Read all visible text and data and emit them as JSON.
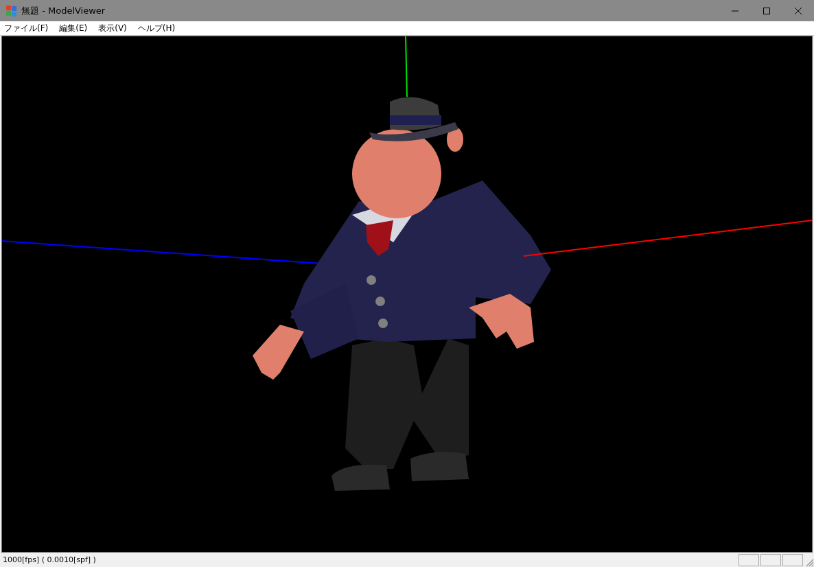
{
  "window": {
    "title": "無題 - ModelViewer"
  },
  "menu": [
    {
      "label": "ファイル(F)"
    },
    {
      "label": "編集(E)"
    },
    {
      "label": "表示(V)"
    },
    {
      "label": "ヘルプ(H)"
    }
  ],
  "status_bar": {
    "text": "1000[fps] ( 0.0010[spf] )"
  }
}
